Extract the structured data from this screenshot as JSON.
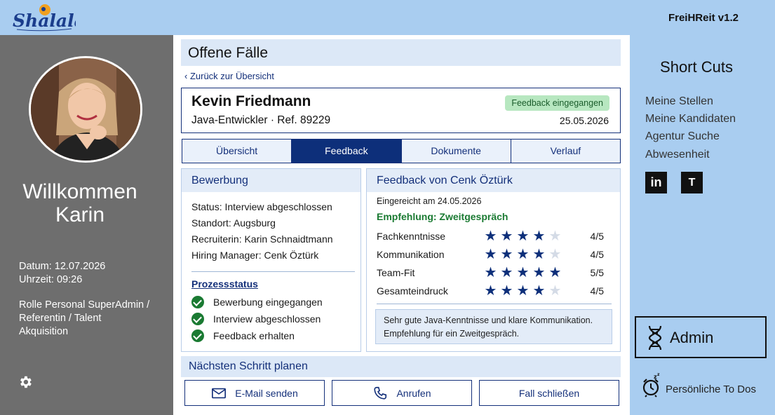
{
  "app": {
    "logo_text": "Shalalala",
    "version": "FreiHReit v1.2"
  },
  "left_sidebar": {
    "welcome_line1": "Willkommen",
    "welcome_line2": "Karin",
    "datum": "Datum: 12.07.2026",
    "uhrzeit": "Uhrzeit: 09:26",
    "rolle": "Rolle Personal SuperAdmin / Referentin / Talent Akquisition",
    "settings_icon": "gear-icon"
  },
  "main": {
    "page_title": "Offene Fälle",
    "back_link": "‹ Zurück zur Übersicht",
    "candidate": {
      "name": "Kevin Friedmann",
      "role": "Java-Entwickler · Ref. 89229",
      "badge": "Feedback eingegangen",
      "date": "25.05.2026",
      "badge_color": "#b7e7c0"
    },
    "tabs": [
      {
        "label": "Übersicht",
        "active": false
      },
      {
        "label": "Feedback",
        "active": true
      },
      {
        "label": "Dokumente",
        "active": false
      },
      {
        "label": "Verlauf",
        "active": false
      }
    ],
    "bewerbung": {
      "title": "Bewerbung",
      "status": "Status:  Interview abgeschlossen",
      "standort": "Standort:  Augsburg",
      "recruiterin": "Recruiterin:  Karin Schnaidtmann",
      "hiring_manager": "Hiring Manager:  Cenk Öztürk",
      "prozess_title": "Prozessstatus",
      "steps": [
        "Bewerbung eingegangen",
        "Interview abgeschlossen",
        "Feedback erhalten"
      ]
    },
    "feedback": {
      "title": "Feedback von Cenk Öztürk",
      "eingereicht": "Eingereicht am 24.05.2026",
      "empfehlung": "Empfehlung: Zweitgespräch",
      "ratings": [
        {
          "label": "Fachkenntnisse",
          "stars": 4,
          "score": "4/5"
        },
        {
          "label": "Kommunikation",
          "stars": 4,
          "score": "4/5"
        },
        {
          "label": "Team-Fit",
          "stars": 5,
          "score": "5/5"
        },
        {
          "label": "Gesamteindruck",
          "stars": 4,
          "score": "4/5"
        }
      ],
      "comment": "Sehr gute Java-Kenntnisse und klare Kommunikation. Empfehlung für ein Zweitgespräch."
    },
    "next_step": {
      "title": "Nächsten Schritt planen",
      "email": "E-Mail senden",
      "call": "Anrufen",
      "close": "Fall schließen"
    }
  },
  "right_sidebar": {
    "title": "Short Cuts",
    "links": [
      "Meine Stellen",
      "Meine Kandidaten",
      "Agentur Suche",
      "Abwesenheit"
    ],
    "social": [
      {
        "icon": "linkedin-icon",
        "text": "in"
      },
      {
        "icon": "teams-icon",
        "text": "T"
      }
    ],
    "admin": "Admin",
    "todos": "Persönliche To Dos"
  },
  "colors": {
    "topbar": "#a9cdf0",
    "sidebar_left": "#6e6e6e",
    "navy": "#0d2f7a",
    "panel_tint": "#e3ecf8",
    "success": "#1a7a32"
  }
}
